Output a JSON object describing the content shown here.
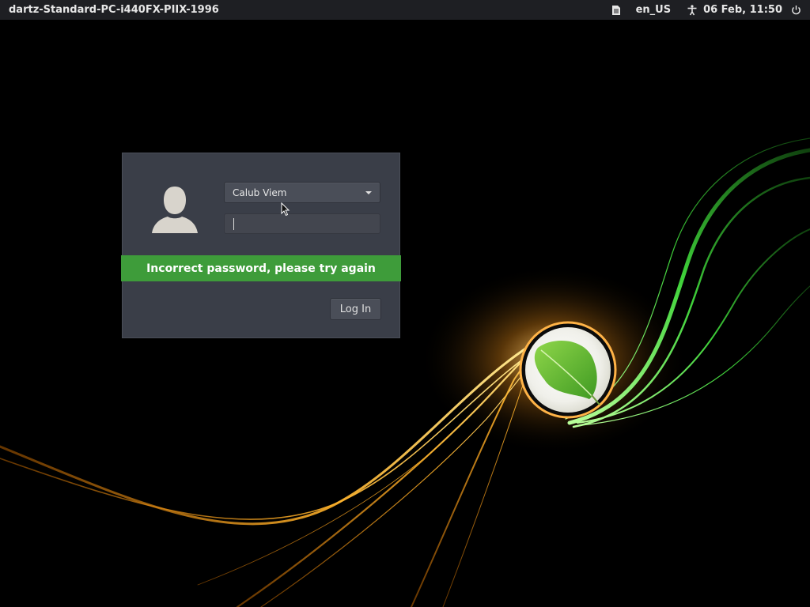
{
  "top_panel": {
    "hostname": "dartz-Standard-PC-i440FX-PIIX-1996",
    "language": "en_US",
    "datetime": "06 Feb, 11:50",
    "icons": [
      "keyboard-layout-icon",
      "accessibility-icon",
      "power-icon"
    ]
  },
  "login": {
    "selected_user": "Calub Viem",
    "password_value": "",
    "error_message": "Incorrect password, please try again",
    "login_button_label": "Log In"
  },
  "colors": {
    "panel_bg": "#1e1f23",
    "dialog_bg": "#3a3e48",
    "error_bar": "#3e9c3a",
    "wallpaper_bg": "#000000"
  },
  "wallpaper": {
    "emblem": "leaf-emblem"
  }
}
